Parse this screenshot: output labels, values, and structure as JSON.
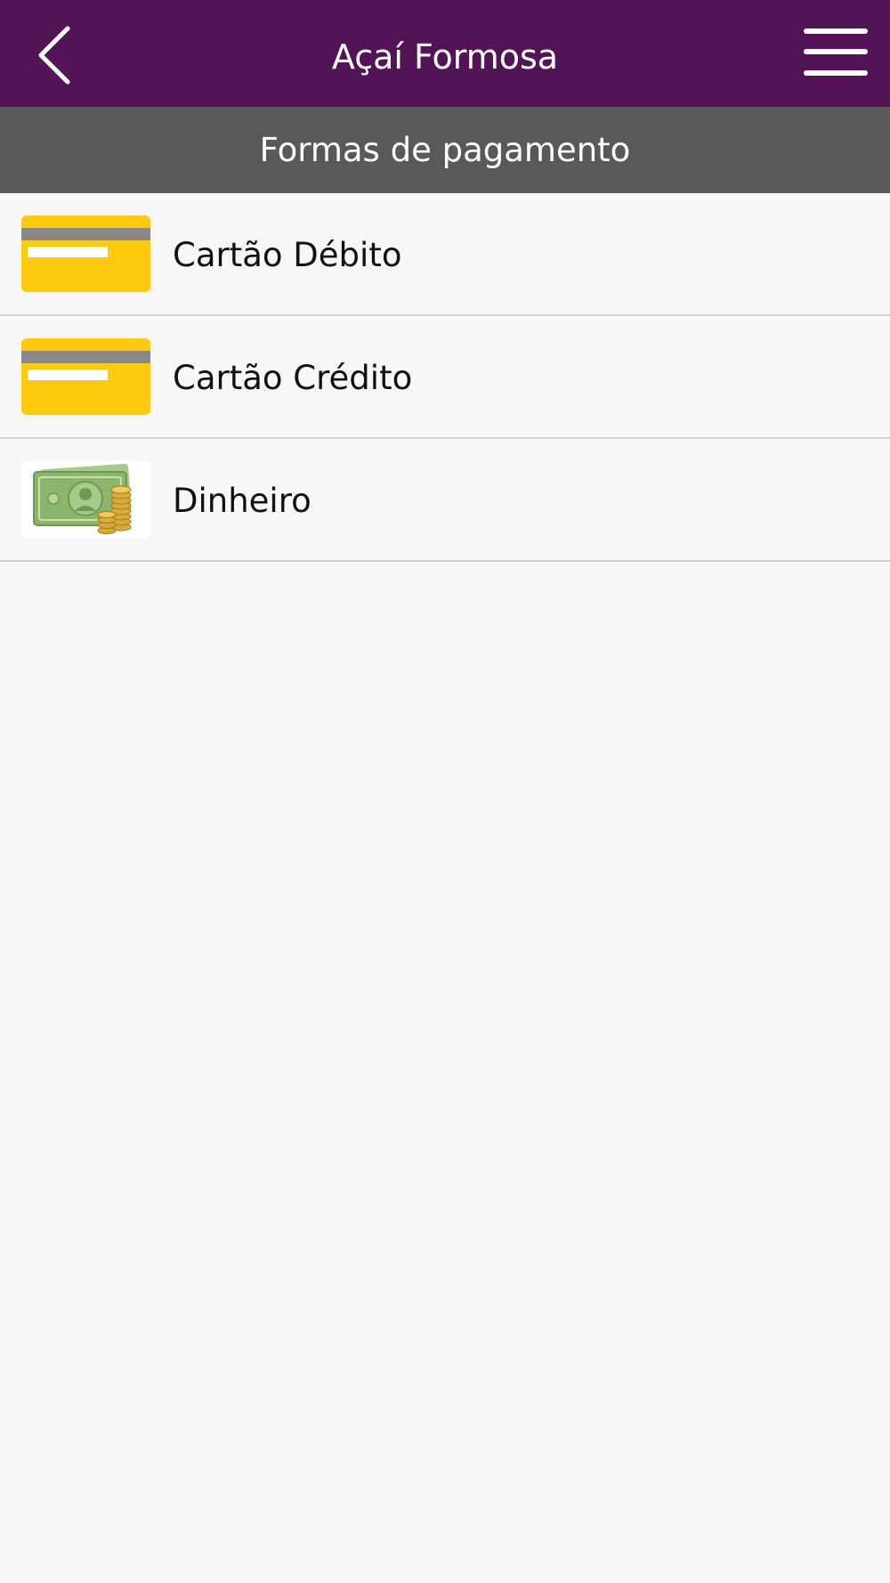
{
  "header": {
    "title": "Açaí Formosa",
    "back_icon": "chevron-left-icon",
    "menu_icon": "hamburger-menu-icon",
    "background_color": "#521457"
  },
  "subheader": {
    "title": "Formas de pagamento",
    "background_color": "#595959"
  },
  "payment_methods": [
    {
      "label": "Cartão Débito",
      "icon": "credit-card-icon"
    },
    {
      "label": "Cartão Crédito",
      "icon": "credit-card-icon"
    },
    {
      "label": "Dinheiro",
      "icon": "cash-money-icon"
    }
  ],
  "colors": {
    "card_yellow": "#ffc90e",
    "card_stripe": "#888888",
    "page_background": "#f7f7f7"
  }
}
